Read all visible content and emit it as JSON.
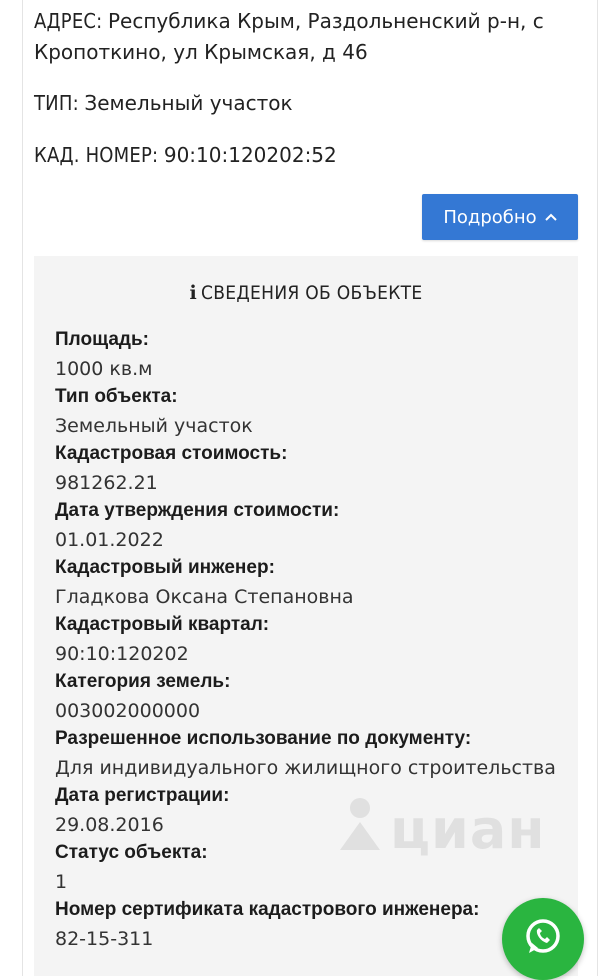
{
  "summary": {
    "address_label": "АДРЕС:",
    "address_value": "Республика Крым, Раздольненский р-н, с Кропоткино, ул Крымская, д 46",
    "type_label": "ТИП:",
    "type_value": "Земельный участок",
    "kad_label": "КАД. НОМЕР:",
    "kad_value": "90:10:120202:52"
  },
  "details_button": {
    "label": "Подробно"
  },
  "panel": {
    "title": "СВЕДЕНИЯ ОБ ОБЪЕКТЕ",
    "fields": [
      {
        "label": "Площадь:",
        "value": "1000 кв.м"
      },
      {
        "label": "Тип объекта:",
        "value": "Земельный участок"
      },
      {
        "label": "Кадастровая стоимость:",
        "value": "981262.21"
      },
      {
        "label": "Дата утверждения стоимости:",
        "value": "01.01.2022"
      },
      {
        "label": "Кадастровый инженер:",
        "value": "Гладкова Оксана Степановна"
      },
      {
        "label": "Кадастровый квартал:",
        "value": "90:10:120202"
      },
      {
        "label": "Категория земель:",
        "value": "003002000000"
      },
      {
        "label": "Разрешенное использование по документу:",
        "value": "Для индивидуального жилищного строительства"
      },
      {
        "label": "Дата регистрации:",
        "value": "29.08.2016"
      },
      {
        "label": "Статус объекта:",
        "value": "1"
      },
      {
        "label": "Номер сертификата кадастрового инженера:",
        "value": "82-15-311"
      }
    ]
  },
  "watermark": {
    "text": "циан"
  },
  "colors": {
    "button": "#3478d4",
    "panel": "#f4f4f4",
    "whatsapp": "#2ab540"
  }
}
